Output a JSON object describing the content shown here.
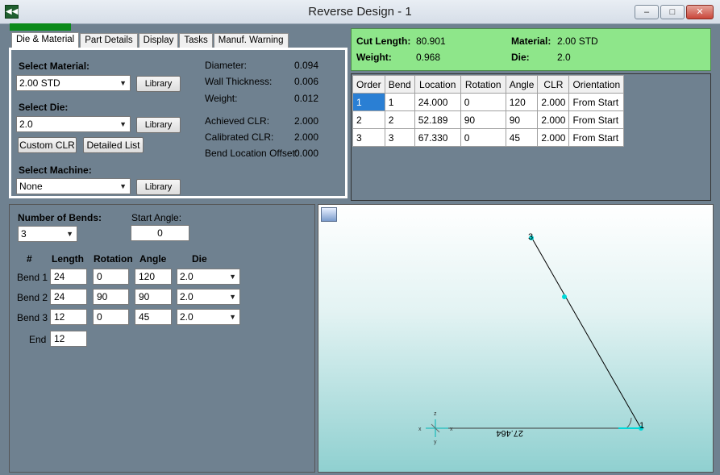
{
  "window": {
    "title": "Reverse Design - 1",
    "min_label": "–",
    "max_label": "□",
    "close_label": "✕"
  },
  "progress": {
    "value": 1.0,
    "color": "#0a8a1a"
  },
  "tabs": [
    {
      "label": "Die & Material",
      "active": true
    },
    {
      "label": "Part Details",
      "active": false
    },
    {
      "label": "Display",
      "active": false
    },
    {
      "label": "Tasks",
      "active": false
    },
    {
      "label": "Manuf. Warning",
      "active": false
    }
  ],
  "die_material": {
    "select_material_label": "Select Material:",
    "material_value": "2.00 STD",
    "select_die_label": "Select Die:",
    "die_value": "2.0",
    "select_machine_label": "Select Machine:",
    "machine_value": "None",
    "library_label": "Library",
    "custom_clr_label": "Custom CLR",
    "detailed_list_label": "Detailed List",
    "props": [
      {
        "label": "Diameter:",
        "value": "0.094"
      },
      {
        "label": "Wall Thickness:",
        "value": "0.006"
      },
      {
        "label": "Weight:",
        "value": "0.012"
      },
      {
        "label": "Achieved CLR:",
        "value": "2.000"
      },
      {
        "label": "Calibrated CLR:",
        "value": "2.000"
      },
      {
        "label": "Bend Location Offset:",
        "value": "0.000"
      }
    ]
  },
  "summary": {
    "cut_length_label": "Cut Length:",
    "cut_length_value": "80.901",
    "weight_label": "Weight:",
    "weight_value": "0.968",
    "material_label": "Material:",
    "material_value": "2.00 STD",
    "die_label": "Die:",
    "die_value": "2.0",
    "background": "#8ee68a"
  },
  "bend_table": {
    "headers": [
      "Order",
      "Bend",
      "Location",
      "Rotation",
      "Angle",
      "CLR",
      "Orientation"
    ],
    "rows": [
      [
        "1",
        "1",
        "24.000",
        "0",
        "120",
        "2.000",
        "From Start"
      ],
      [
        "2",
        "2",
        "52.189",
        "90",
        "90",
        "2.000",
        "From Start"
      ],
      [
        "3",
        "3",
        "67.330",
        "0",
        "45",
        "2.000",
        "From Start"
      ]
    ],
    "selected_color": "#2a7fd4"
  },
  "bends_input": {
    "number_of_bends_label": "Number of Bends:",
    "number_of_bends_value": "3",
    "start_angle_label": "Start Angle:",
    "start_angle_value": "0",
    "col_hash": "#",
    "col_length": "Length",
    "col_rotation": "Rotation",
    "col_angle": "Angle",
    "col_die": "Die",
    "rows": [
      {
        "label": "Bend 1",
        "length": "24",
        "rotation": "0",
        "angle": "120",
        "die": "2.0"
      },
      {
        "label": "Bend 2",
        "length": "24",
        "rotation": "90",
        "angle": "90",
        "die": "2.0"
      },
      {
        "label": "Bend 3",
        "length": "12",
        "rotation": "0",
        "angle": "45",
        "die": "2.0"
      }
    ],
    "end_label": "End",
    "end_value": "12"
  },
  "view": {
    "icon": "camera-view-icon",
    "point_1_label": "1",
    "point_3_label": "3",
    "dimension_label": "27.464",
    "axis_x_label": "x",
    "axis_y_label": "y",
    "axis_z_label": "z"
  }
}
